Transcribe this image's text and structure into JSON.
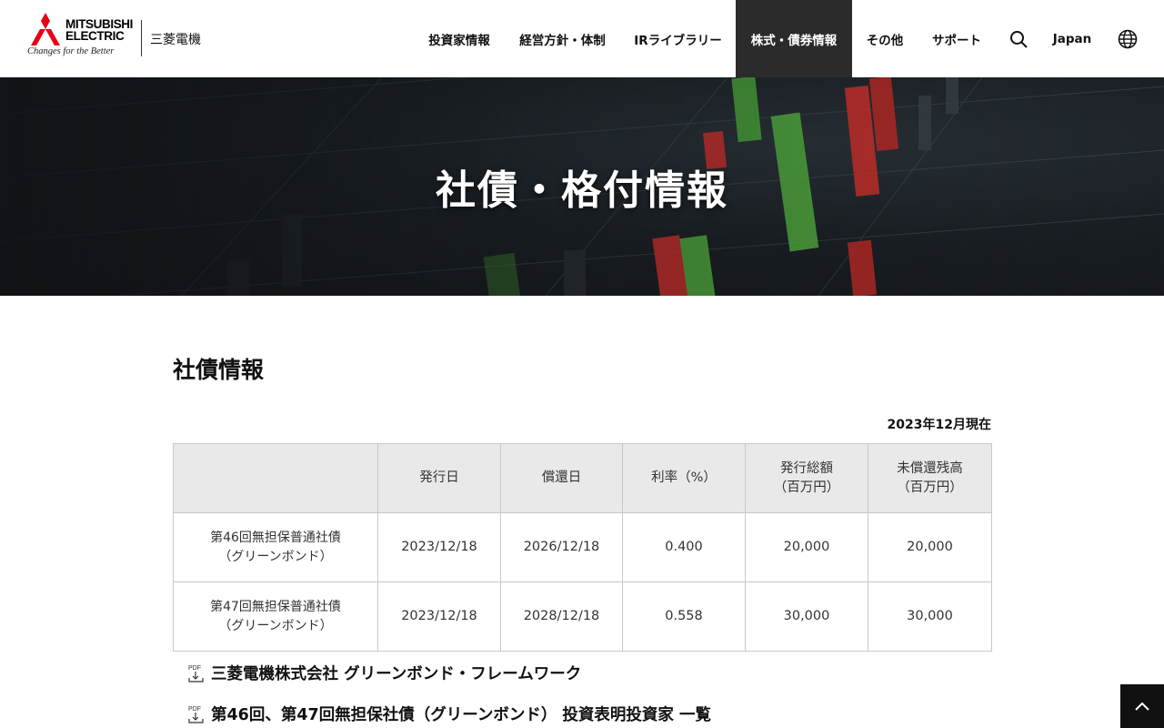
{
  "brand": {
    "name_line1": "MITSUBISHI",
    "name_line2": "ELECTRIC",
    "tagline": "Changes for the Better",
    "name_jp": "三菱電機",
    "logo_color": "#e60012"
  },
  "nav": {
    "items": [
      {
        "label": "投資家情報",
        "active": false
      },
      {
        "label": "経営方針・体制",
        "active": false
      },
      {
        "label": "IRライブラリー",
        "active": false
      },
      {
        "label": "株式・債券情報",
        "active": true
      },
      {
        "label": "その他",
        "active": false
      },
      {
        "label": "サポート",
        "active": false
      }
    ],
    "search_icon": "search-icon",
    "region_label": "Japan",
    "globe_icon": "globe-icon"
  },
  "hero": {
    "title": "社債・格付情報"
  },
  "section": {
    "title": "社債情報",
    "as_of": "2023年12月現在"
  },
  "table": {
    "headers": [
      "",
      "発行日",
      "償還日",
      "利率（%）",
      "発行総額\n（百万円）",
      "未償還残高\n（百万円）"
    ],
    "rows": [
      {
        "name_line1": "第46回無担保普通社債",
        "name_line2": "（グリーンボンド）",
        "issue_date": "2023/12/18",
        "redemption_date": "2026/12/18",
        "rate": "0.400",
        "issue_amount": "20,000",
        "outstanding": "20,000"
      },
      {
        "name_line1": "第47回無担保普通社債",
        "name_line2": "（グリーンボンド）",
        "issue_date": "2023/12/18",
        "redemption_date": "2028/12/18",
        "rate": "0.558",
        "issue_amount": "30,000",
        "outstanding": "30,000"
      }
    ]
  },
  "documents": [
    {
      "label": "三菱電機株式会社 グリーンボンド・フレームワーク",
      "icon": "pdf-icon",
      "icon_text": "PDF"
    },
    {
      "label": "第46回、第47回無担保社債（グリーンボンド） 投資表明投資家 一覧",
      "icon": "pdf-icon",
      "icon_text": "PDF"
    }
  ],
  "back_to_top_icon": "chevron-up-icon"
}
